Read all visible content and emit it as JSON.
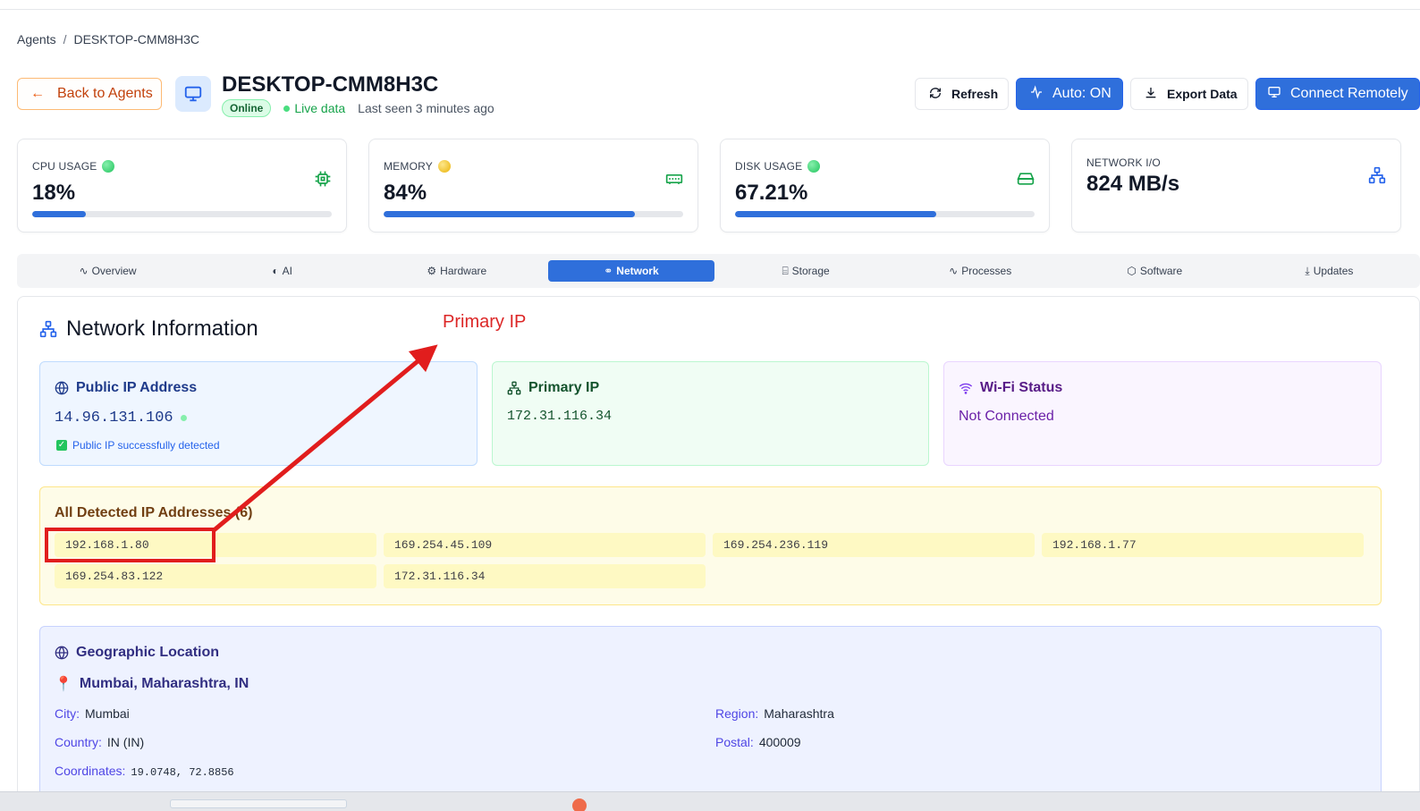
{
  "breadcrumb": {
    "root": "Agents",
    "separator": "/",
    "current": "DESKTOP-CMM8H3C"
  },
  "header": {
    "back_label": "Back to Agents",
    "hostname": "DESKTOP-CMM8H3C",
    "status_badge": "Online",
    "live_label": "Live data",
    "last_seen": "Last seen 3 minutes ago",
    "icon": "monitor-icon"
  },
  "actions": {
    "refresh": "Refresh",
    "auto": "Auto: ON",
    "export": "Export Data",
    "connect": "Connect Remotely"
  },
  "metrics": {
    "cpu": {
      "label": "CPU USAGE",
      "value": "18%",
      "progress": 0.18,
      "status_color": "#22c55e",
      "icon": "cpu-icon"
    },
    "memory": {
      "label": "MEMORY",
      "value": "84%",
      "progress": 0.84,
      "status_color": "#eab308",
      "icon": "memory-icon"
    },
    "disk": {
      "label": "DISK USAGE",
      "value": "67.21%",
      "progress": 0.6721,
      "status_color": "#22c55e",
      "icon": "hard-drive-icon"
    },
    "network": {
      "label": "NETWORK I/O",
      "value": "824 MB/s",
      "icon": "network-icon"
    }
  },
  "tabs": [
    {
      "label": "Overview",
      "icon": "activity-icon"
    },
    {
      "label": "AI",
      "icon": "ai-icon"
    },
    {
      "label": "Hardware",
      "icon": "chip-icon"
    },
    {
      "label": "Network",
      "icon": "network-icon",
      "active": true
    },
    {
      "label": "Storage",
      "icon": "storage-icon"
    },
    {
      "label": "Processes",
      "icon": "activity-icon"
    },
    {
      "label": "Software",
      "icon": "package-icon"
    },
    {
      "label": "Updates",
      "icon": "download-icon"
    }
  ],
  "network": {
    "title": "Network Information",
    "public_ip": {
      "title": "Public IP Address",
      "value": "14.96.131.106",
      "note": "Public IP successfully detected"
    },
    "primary_ip": {
      "title": "Primary IP",
      "value": "172.31.116.34"
    },
    "wifi": {
      "title": "Wi-Fi Status",
      "value": "Not Connected"
    },
    "all_ips": {
      "title": "All Detected IP Addresses (6)",
      "items": [
        "192.168.1.80",
        "169.254.45.109",
        "169.254.236.119",
        "192.168.1.77",
        "169.254.83.122",
        "172.31.116.34"
      ]
    },
    "geo": {
      "title": "Geographic Location",
      "place": "Mumbai, Maharashtra, IN",
      "city_label": "City:",
      "city": "Mumbai",
      "region_label": "Region:",
      "region": "Maharashtra",
      "country_label": "Country:",
      "country": "IN (IN)",
      "postal_label": "Postal:",
      "postal": "400009",
      "coords_label": "Coordinates:",
      "coords": "19.0748, 72.8856"
    }
  },
  "annotation": {
    "label": "Primary IP",
    "color": "#e11d1d"
  },
  "colors": {
    "accent": "#2f6fdb",
    "back_button": "#c2410c",
    "online": "#16a34a"
  }
}
